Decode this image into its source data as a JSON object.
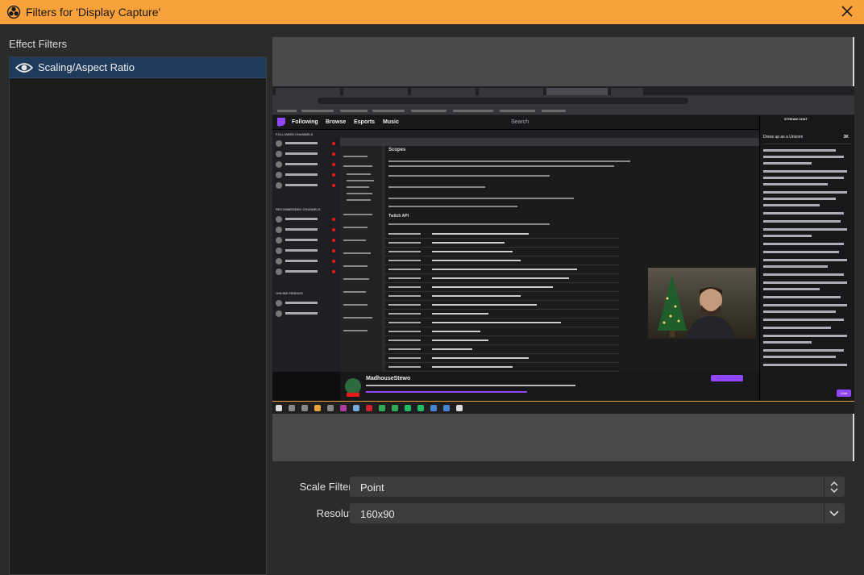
{
  "window": {
    "title": "Filters for 'Display Capture'",
    "close_label": "×"
  },
  "filters_panel": {
    "header": "Effect Filters",
    "items": [
      {
        "label": "Scaling/Aspect Ratio",
        "visible": true,
        "selected": true
      }
    ]
  },
  "properties": {
    "scale_filtering": {
      "label": "Scale Filtering",
      "value": "Point"
    },
    "resolution": {
      "label": "Resolution",
      "value": "160x90"
    }
  },
  "preview": {
    "twitch_nav": [
      "Following",
      "Browse",
      "Esports",
      "Music"
    ],
    "search_text": "Search",
    "sidebar_followed_header": "FOLLOWED CHANNELS",
    "sidebar_recommended_header": "RECOMMENDED CHANNELS",
    "sidebar_friends_header": "ONLINE FRIENDS",
    "stream_title": "MadhouseStewo",
    "chat_header": "STREAM CHAT",
    "chat_banner": "Dress up as a Unicorn",
    "chat_banner_value": "3K",
    "chat_send_label": "Chat",
    "doc_heading": "Scopes",
    "doc_subheading": "Twitch API"
  },
  "colors": {
    "titlebar": "#f9a13b",
    "selected_item": "#1f3b5c",
    "twitch_purple": "#9147ff"
  }
}
